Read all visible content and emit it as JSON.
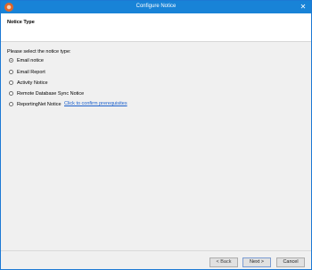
{
  "window": {
    "title": "Configure Notice"
  },
  "header": {
    "title": "Notice Type"
  },
  "content": {
    "prompt": "Please select the notice type:",
    "options": [
      {
        "label": "Email notice",
        "checked": true
      },
      {
        "label": "Email Report",
        "checked": false
      },
      {
        "label": "Activity Notice",
        "checked": false
      },
      {
        "label": "Remote Database Sync Notice",
        "checked": false
      },
      {
        "label": "ReportingNet Notice",
        "checked": false
      }
    ],
    "prereq_link": "Click to confirm prerequisites"
  },
  "footer": {
    "back_label": "< Back",
    "next_label": "Next >",
    "cancel_label": "Cancel"
  },
  "icons": {
    "app": "app-icon",
    "close": "close-icon"
  }
}
